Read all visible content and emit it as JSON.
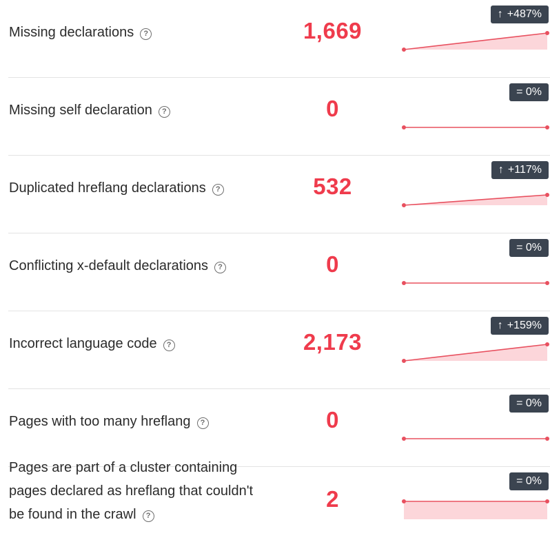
{
  "colors": {
    "value": "#ef3b4c",
    "spark_line": "#e8505f",
    "spark_fill": "#fcd6da",
    "badge_bg": "#3b4450"
  },
  "rows": [
    {
      "label": "Missing declarations",
      "help_icon": "?",
      "value": "1,669",
      "badge": {
        "arrow": "↑",
        "text": "+487%",
        "trend": "up"
      },
      "spark": [
        0.0,
        1.0
      ]
    },
    {
      "label": "Missing self declaration",
      "help_icon": "?",
      "value": "0",
      "badge": {
        "arrow": "",
        "text": "= 0%",
        "trend": "flat"
      },
      "spark": [
        0.0,
        0.0
      ]
    },
    {
      "label": "Duplicated hreflang declarations",
      "help_icon": "?",
      "value": "532",
      "badge": {
        "arrow": "↑",
        "text": "+117%",
        "trend": "up"
      },
      "spark": [
        0.0,
        1.0
      ]
    },
    {
      "label": "Conflicting x-default declarations",
      "help_icon": "?",
      "value": "0",
      "badge": {
        "arrow": "",
        "text": "= 0%",
        "trend": "flat"
      },
      "spark": [
        0.0,
        0.0
      ]
    },
    {
      "label": "Incorrect language code",
      "help_icon": "?",
      "value": "2,173",
      "badge": {
        "arrow": "↑",
        "text": "+159%",
        "trend": "up"
      },
      "spark": [
        0.0,
        1.0
      ]
    },
    {
      "label": "Pages with too many hreflang",
      "help_icon": "?",
      "value": "0",
      "badge": {
        "arrow": "",
        "text": "= 0%",
        "trend": "flat"
      },
      "spark": [
        0.0,
        0.0
      ]
    },
    {
      "label": "Pages are part of a cluster containing pages declared as hreflang that couldn't be found in the crawl",
      "help_icon": "?",
      "value": "2",
      "badge": {
        "arrow": "",
        "text": "= 0%",
        "trend": "flat"
      },
      "spark": [
        1.0,
        1.0
      ]
    }
  ]
}
